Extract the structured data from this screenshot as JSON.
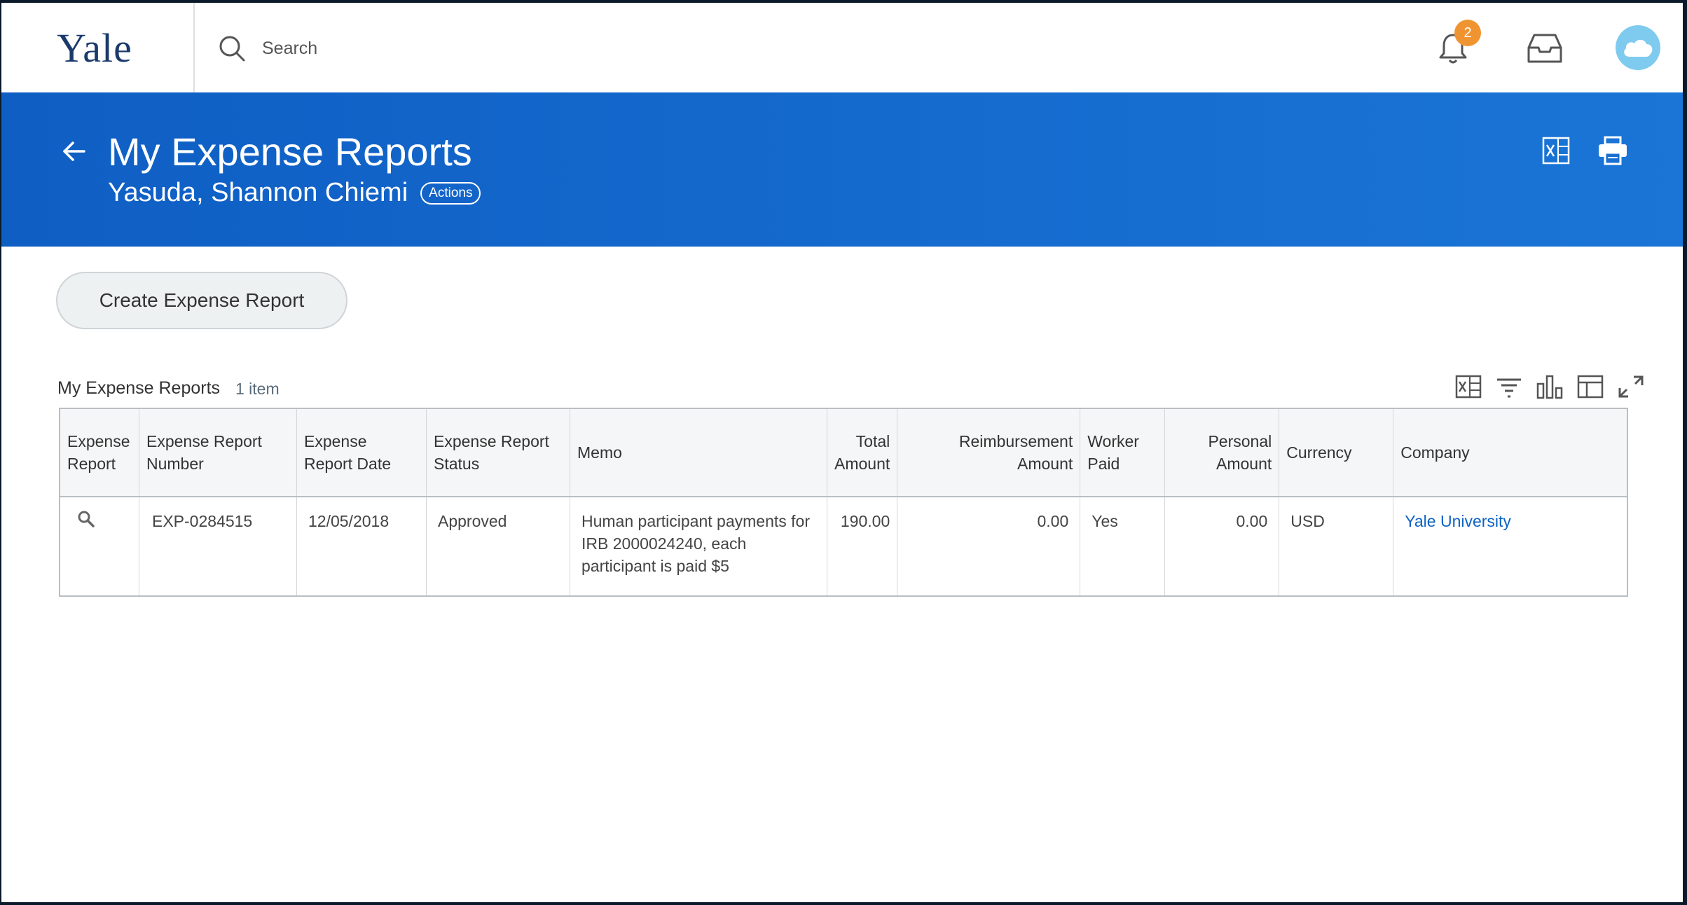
{
  "brand": {
    "logo_text": "Yale"
  },
  "search": {
    "placeholder": "Search"
  },
  "notifications": {
    "count": "2"
  },
  "header": {
    "title": "My Expense Reports",
    "subtitle": "Yasuda, Shannon Chiemi",
    "actions_label": "Actions"
  },
  "buttons": {
    "create": "Create Expense Report"
  },
  "grid": {
    "title": "My Expense Reports",
    "count": "1 item",
    "columns": {
      "c0": "Expense Report",
      "c1": "Expense Report Number",
      "c2": "Expense Report Date",
      "c3": "Expense Report Status",
      "c4": "Memo",
      "c5": "Total Amount",
      "c6": "Reimbursement Amount",
      "c7": "Worker Paid",
      "c8": "Personal Amount",
      "c9": "Currency",
      "c10": "Company"
    },
    "rows": [
      {
        "number": "EXP-0284515",
        "date": "12/05/2018",
        "status": "Approved",
        "memo": "Human participant payments for IRB 2000024240, each participant is paid $5",
        "total": "190.00",
        "reimbursement": "0.00",
        "worker_paid": "Yes",
        "personal": "0.00",
        "currency": "USD",
        "company": "Yale University"
      }
    ]
  },
  "colors": {
    "header_blue": "#1a6fd3",
    "badge_orange": "#f09431",
    "link_blue": "#0d62c4",
    "logo_navy": "#1a3a6b"
  },
  "icons": [
    "search-icon",
    "bell-icon",
    "inbox-icon",
    "cloud-avatar-icon",
    "back-arrow-icon",
    "excel-export-icon",
    "print-icon",
    "filter-icon",
    "chart-icon",
    "columns-icon",
    "fullscreen-icon",
    "magnifier-icon"
  ]
}
